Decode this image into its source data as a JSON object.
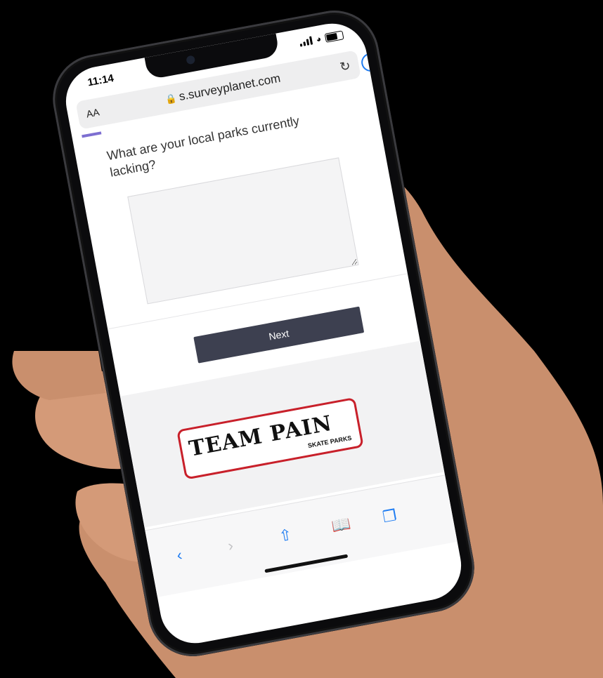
{
  "status": {
    "time": "11:14"
  },
  "browser": {
    "text_size_label": "AA",
    "url": "s.surveyplanet.com"
  },
  "survey": {
    "question": "What are your local parks currently lacking?",
    "answer_value": "",
    "next_label": "Next"
  },
  "logo": {
    "main": "TEAM PAIN",
    "sub": "SKATE PARKS"
  },
  "toolbar": {
    "back_icon": "chevron-left-icon",
    "forward_icon": "chevron-right-icon",
    "share_icon": "share-icon",
    "bookmarks_icon": "book-icon",
    "tabs_icon": "tabs-icon"
  },
  "colors": {
    "accent": "#1e7cf2",
    "button": "#3d4050",
    "logo_border": "#c8202a"
  }
}
